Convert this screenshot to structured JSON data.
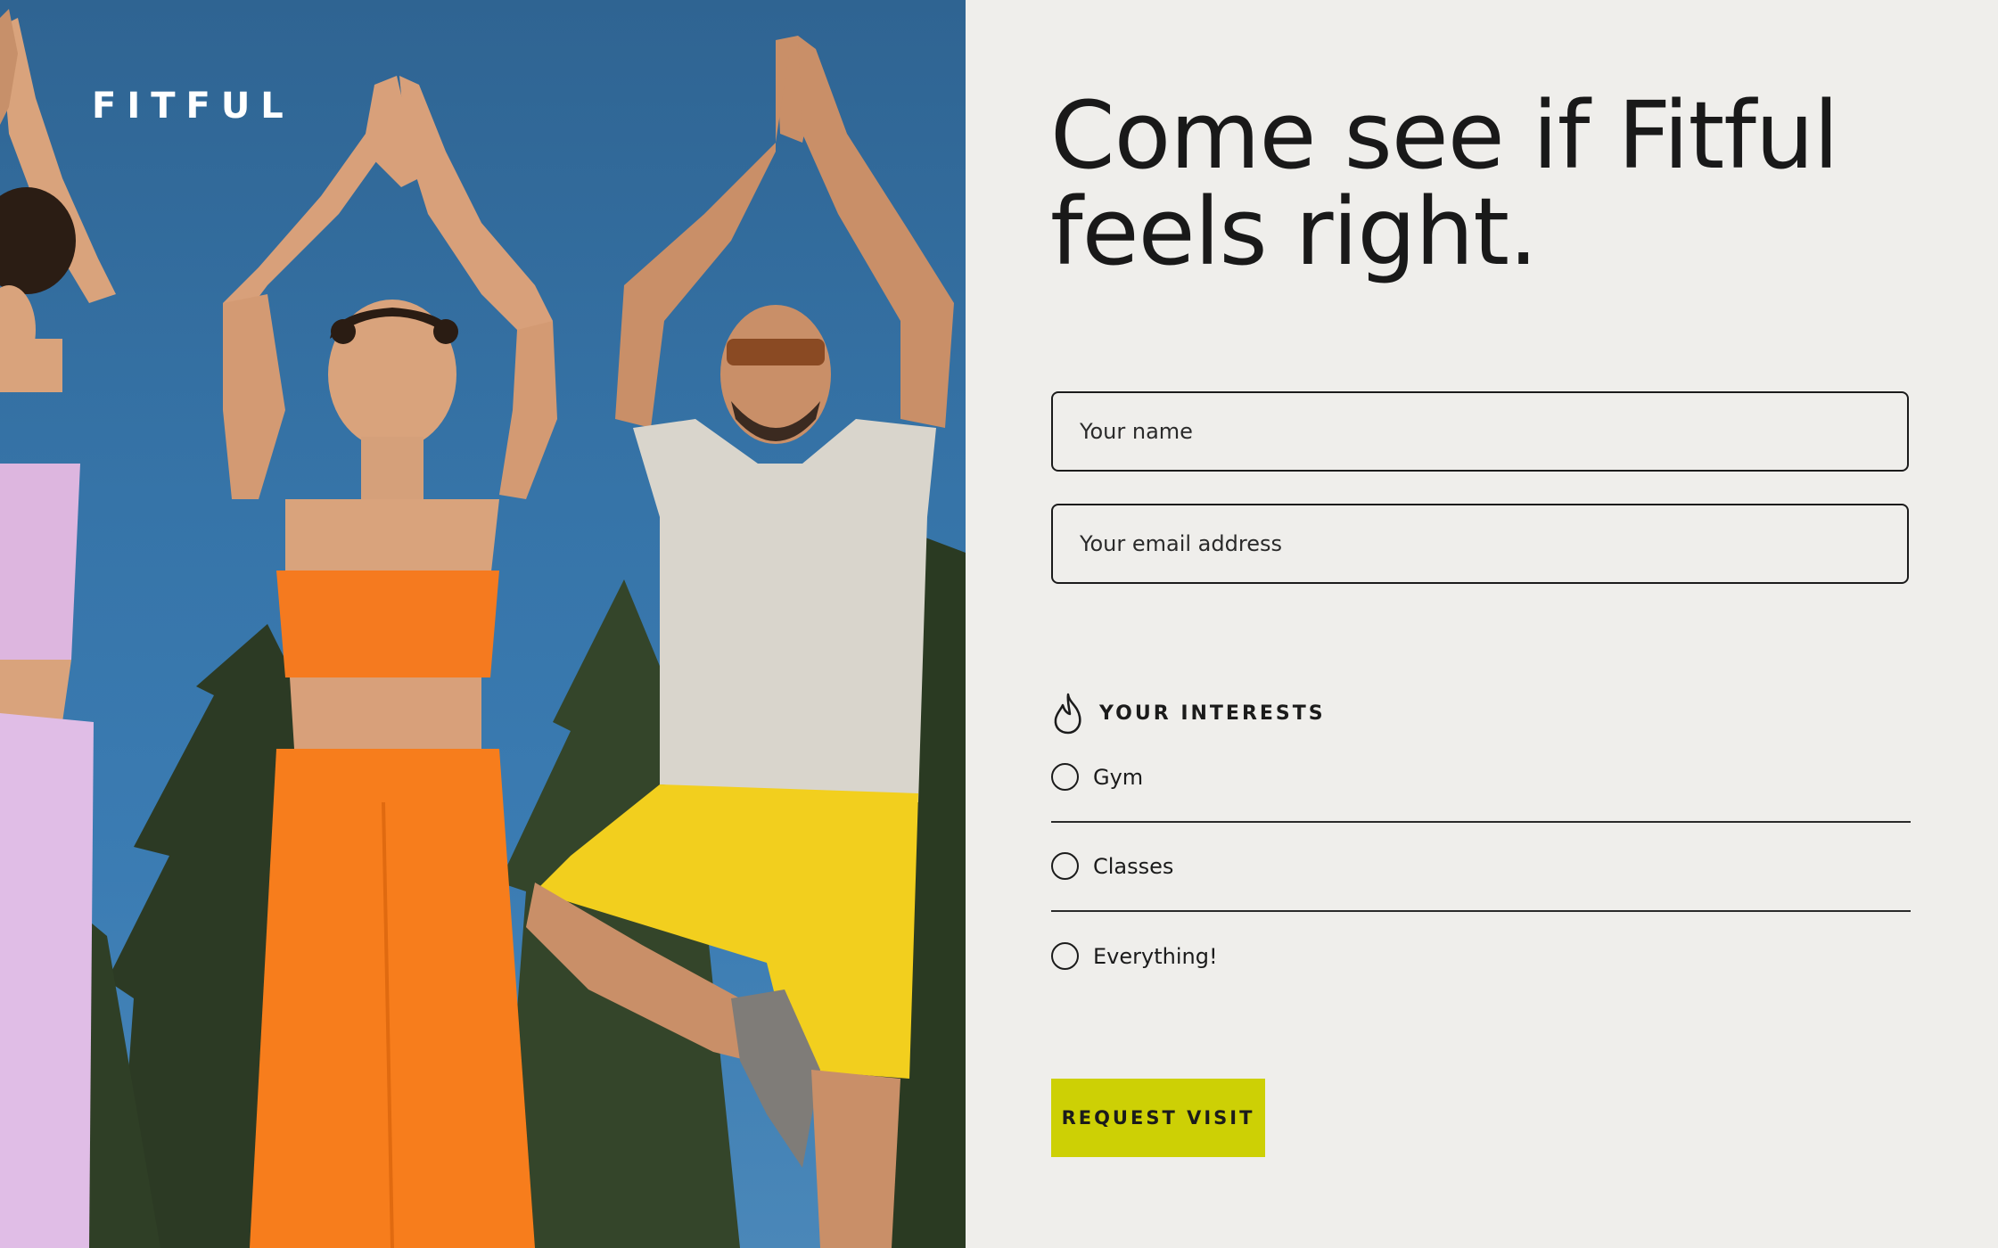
{
  "brand": {
    "logo_text": "FITFUL"
  },
  "hero": {
    "image": "three-people-yoga-tree-pose-photo"
  },
  "form": {
    "headline_line1": "Come see if Fitful",
    "headline_line2": "feels right.",
    "name_placeholder": "Your name",
    "email_placeholder": "Your email address",
    "interests": {
      "icon": "flame-icon",
      "title": "YOUR INTERESTS",
      "options": [
        {
          "label": "Gym",
          "selected": false
        },
        {
          "label": "Classes",
          "selected": false
        },
        {
          "label": "Everything!",
          "selected": false
        }
      ]
    },
    "submit_label": "REQUEST VISIT"
  },
  "colors": {
    "panel_bg": "#efeeeb",
    "text": "#1b1b1b",
    "button_accent": "#cdd005",
    "sky": "#3674a8"
  }
}
